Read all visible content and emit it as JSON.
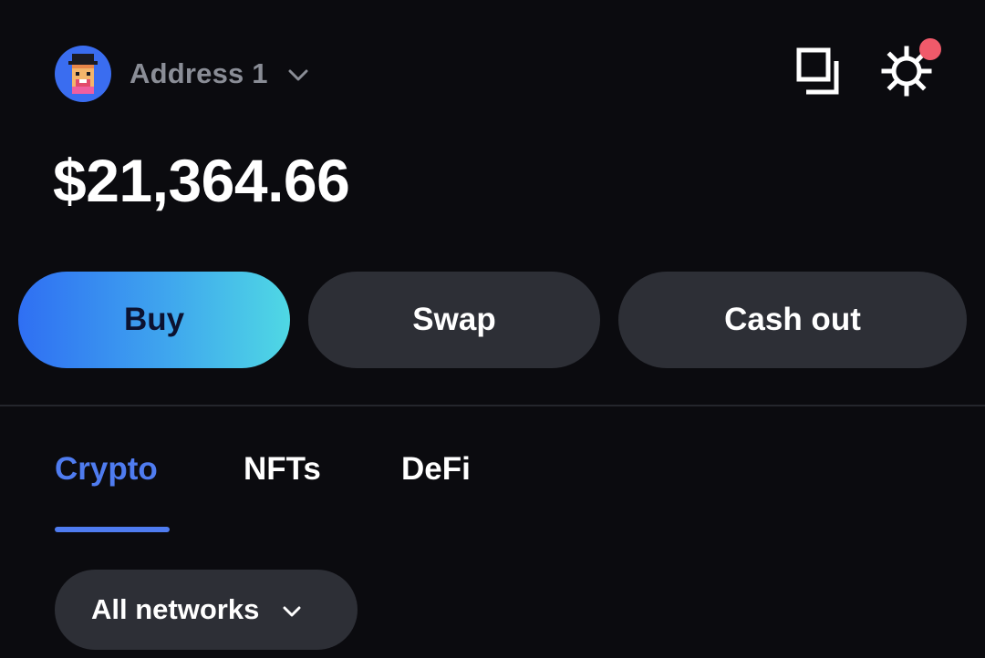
{
  "header": {
    "address_label": "Address 1",
    "avatar_icon": "pixel-character-avatar-icon",
    "chevron_icon": "chevron-down-icon"
  },
  "top_icons": {
    "copy_icon": "copy-icon",
    "settings_icon": "gear-icon",
    "notification_badge_color": "#f05a6a"
  },
  "balance": {
    "amount": "$21,364.66"
  },
  "actions": {
    "buy_label": "Buy",
    "swap_label": "Swap",
    "cash_out_label": "Cash out"
  },
  "tabs": [
    {
      "label": "Crypto",
      "active": true
    },
    {
      "label": "NFTs",
      "active": false
    },
    {
      "label": "DeFi",
      "active": false
    }
  ],
  "network_filter": {
    "selected": "All networks",
    "chevron_icon": "chevron-down-icon"
  },
  "colors": {
    "background": "#0b0b0f",
    "accent": "#4f7cf0",
    "button_surface": "#2d2f36",
    "buy_gradient_start": "#2f6ff3",
    "buy_gradient_end": "#4fd8e4",
    "muted_text": "#8a8d96"
  }
}
